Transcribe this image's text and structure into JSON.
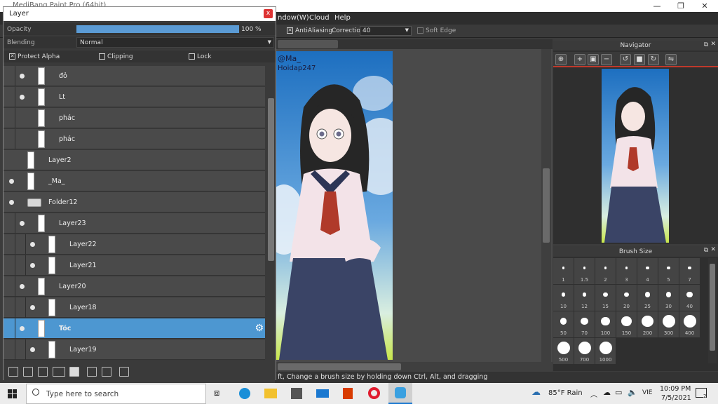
{
  "app": {
    "title": "MediBang Paint Pro (64bit)"
  },
  "window_controls": {
    "minimize": "—",
    "maximize": "❐",
    "close": "✕"
  },
  "menu": {
    "items": [
      "ndow(W)",
      "Cloud",
      "Help"
    ]
  },
  "toolbar": {
    "antialiasing": "AntiAliasing",
    "correction_label": "Correction",
    "correction_value": "40",
    "soft_edge": "Soft Edge"
  },
  "layer_panel": {
    "title": "Layer",
    "close": "x",
    "opacity_label": "Opacity",
    "opacity_value": "100 %",
    "opacity_fraction": 1.0,
    "blending_label": "Blending",
    "blending_value": "Normal",
    "protect_alpha": "Protect Alpha",
    "clipping": "Clipping",
    "lock": "Lock",
    "layers": [
      {
        "name": "đỏ",
        "visible": true,
        "indent": 1
      },
      {
        "name": "Lt",
        "visible": true,
        "indent": 1
      },
      {
        "name": "phác",
        "visible": false,
        "indent": 1
      },
      {
        "name": "phác",
        "visible": false,
        "indent": 1
      },
      {
        "name": "Layer2",
        "visible": false,
        "indent": 0
      },
      {
        "name": "_Ma_",
        "visible": true,
        "indent": 0
      },
      {
        "name": "Folder12",
        "visible": true,
        "indent": 0,
        "folder": true
      },
      {
        "name": "Layer23",
        "visible": true,
        "indent": 1
      },
      {
        "name": "Layer22",
        "visible": true,
        "indent": 2
      },
      {
        "name": "Layer21",
        "visible": true,
        "indent": 2
      },
      {
        "name": "Layer20",
        "visible": true,
        "indent": 1
      },
      {
        "name": "Layer18",
        "visible": true,
        "indent": 2
      },
      {
        "name": "Tóc",
        "visible": true,
        "indent": 1,
        "selected": true
      },
      {
        "name": "Layer19",
        "visible": true,
        "indent": 2
      }
    ]
  },
  "canvas": {
    "watermark": "@Ma_\nHoidap247"
  },
  "navigator": {
    "title": "Navigator"
  },
  "brush_size": {
    "title": "Brush Size",
    "sizes": [
      "1",
      "1.5",
      "2",
      "3",
      "4",
      "5",
      "7",
      "10",
      "12",
      "15",
      "20",
      "25",
      "30",
      "40",
      "50",
      "70",
      "100",
      "150",
      "200",
      "300",
      "400",
      "500",
      "700",
      "1000"
    ]
  },
  "status": {
    "text": "ft, Change a brush size by holding down Ctrl, Alt, and dragging"
  },
  "taskbar": {
    "search_placeholder": "Type here to search",
    "weather": "85°F  Rain",
    "language": "VIE",
    "time": "10:09 PM",
    "date": "7/5/2021",
    "notifications": "2"
  },
  "colors": {
    "accent": "#4d97d1",
    "close_red": "#d33333"
  }
}
